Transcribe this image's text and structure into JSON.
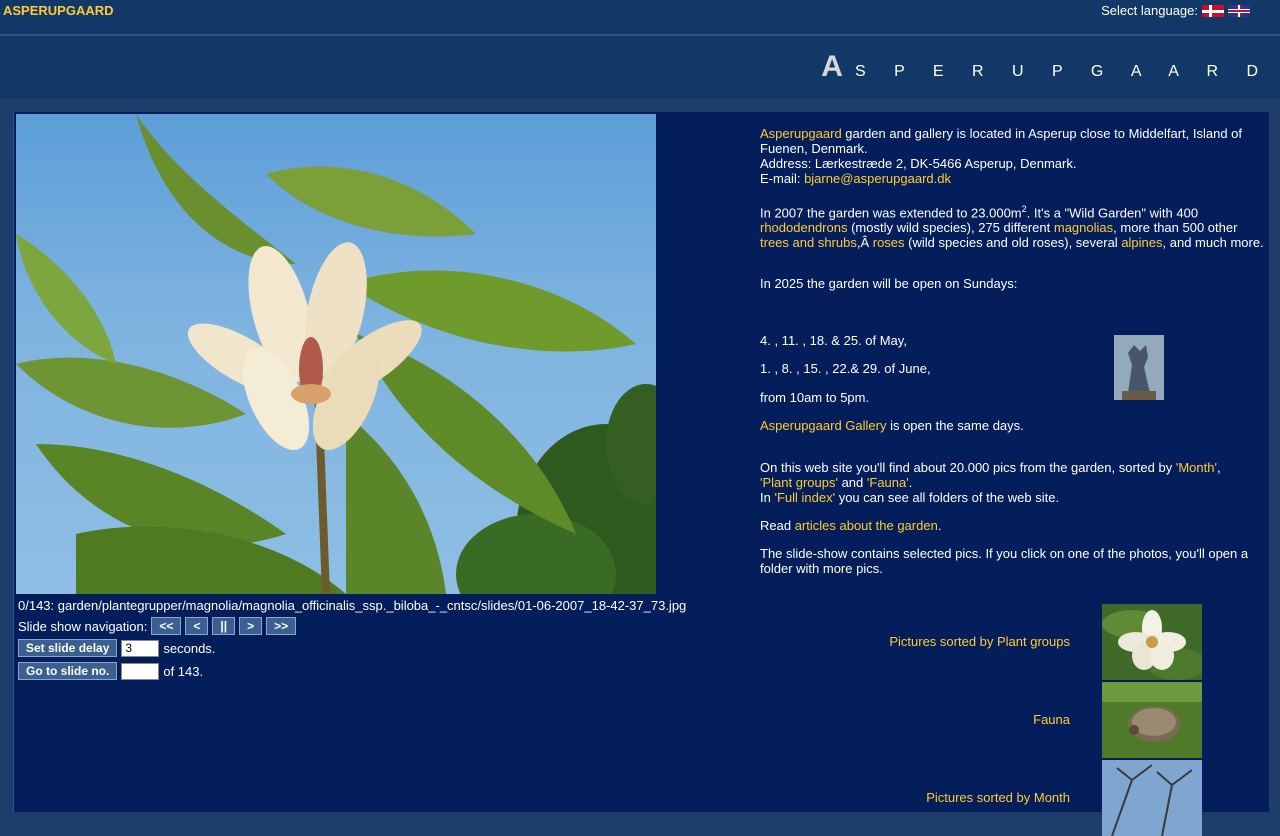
{
  "header": {
    "brand": "ASPERUPGAARD",
    "language_label": "Select language:",
    "flags": [
      "danish-flag-icon",
      "english-flag-icon"
    ]
  },
  "banner": {
    "first_letter": "A",
    "rest": "S P E R U P G A A R D"
  },
  "slideshow": {
    "caption": "0/143: garden/plantegrupper/magnolia/magnolia_officinalis_ssp._biloba_-_cntsc/slides/01-06-2007_18-42-37_73.jpg",
    "nav_label": "Slide show navigation:",
    "nav_buttons": [
      "<<",
      "<",
      "||",
      ">",
      ">>"
    ],
    "delay_button": "Set slide delay",
    "delay_value": "3",
    "delay_suffix": "seconds.",
    "goto_button": "Go to slide no.",
    "goto_value": "",
    "goto_suffix": "of 143."
  },
  "info": {
    "intro_link": "Asperupgaard",
    "intro_text": " garden and gallery is located in Asperup close to Middelfart, Island of Fuenen, Denmark.",
    "address": "Address: Lærkestræde 2, DK-5466 Asperup, Denmark.",
    "email_label": "E-mail: ",
    "email": "bjarne@asperupgaard.dk",
    "ext_text1": "In 2007 the garden was extended to 23.000m",
    "ext_sup": "2",
    "ext_text2": ". It's a \"Wild Garden\" with 400 ",
    "rhodo": "rhododendrons",
    "ext_text3": " (mostly wild species), 275 different ",
    "magnolias": "magnolias",
    "ext_text4": ", more than 500 other ",
    "trees": "trees and shrubs",
    "ext_text5": ",Â  ",
    "roses": "roses",
    "ext_text6": " (wild species and old roses), several ",
    "alpines": "alpines",
    "ext_text7": ", and much more.",
    "open_text": "In 2025  the garden will be open on  Sundays:",
    "dates_may": "4. , 11. , 18. & 25. of May,",
    "dates_june": "1. , 8. , 15. , 22.& 29. of June,",
    "hours": "from 10am to 5pm.",
    "gallery_link": "Asperupgaard Gallery",
    "gallery_text": " is open the same days.",
    "site_text1": "On this web site you'll find about 20.000 pics from the garden, sorted by ",
    "month_link": "'Month'",
    "comma": ",",
    "plant_link": "'Plant groups'",
    "and": " and ",
    "fauna_link": "'Fauna'",
    "period": ".",
    "in": "In ",
    "index_link": "'Full index'",
    "index_text": " you can see all folders of the web site.",
    "read": "Read ",
    "articles_link": "articles about the garden",
    "slideshow_text": "The slide-show contains selected pics. If you click on one of the photos, you'll open a folder with more pics."
  },
  "gallery_links": [
    {
      "label": "Pictures sorted by Plant groups",
      "icon": "white-magnolia-flower-thumbnail"
    },
    {
      "label": "Fauna",
      "icon": "hedgehog-thumbnail"
    },
    {
      "label": "Pictures sorted by Month",
      "icon": "winter-tree-thumbnail"
    }
  ],
  "colors": {
    "background": "#1f3d6a",
    "content_bg": "#041e5c",
    "header_bg": "#123868",
    "link": "#ffcc33",
    "text": "#ffffff"
  }
}
